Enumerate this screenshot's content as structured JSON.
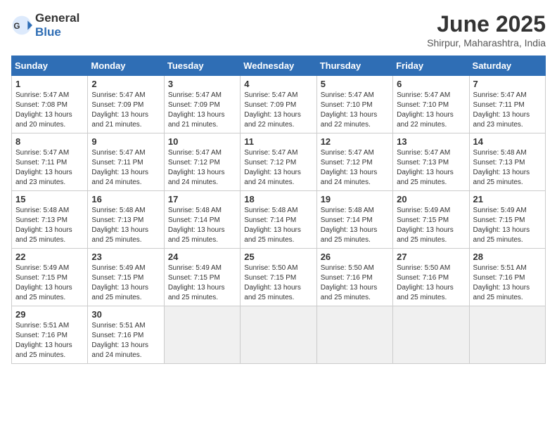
{
  "header": {
    "logo_general": "General",
    "logo_blue": "Blue",
    "month_year": "June 2025",
    "location": "Shirpur, Maharashtra, India"
  },
  "weekdays": [
    "Sunday",
    "Monday",
    "Tuesday",
    "Wednesday",
    "Thursday",
    "Friday",
    "Saturday"
  ],
  "weeks": [
    [
      {
        "day": "1",
        "lines": [
          "Sunrise: 5:47 AM",
          "Sunset: 7:08 PM",
          "Daylight: 13 hours",
          "and 20 minutes."
        ]
      },
      {
        "day": "2",
        "lines": [
          "Sunrise: 5:47 AM",
          "Sunset: 7:09 PM",
          "Daylight: 13 hours",
          "and 21 minutes."
        ]
      },
      {
        "day": "3",
        "lines": [
          "Sunrise: 5:47 AM",
          "Sunset: 7:09 PM",
          "Daylight: 13 hours",
          "and 21 minutes."
        ]
      },
      {
        "day": "4",
        "lines": [
          "Sunrise: 5:47 AM",
          "Sunset: 7:09 PM",
          "Daylight: 13 hours",
          "and 22 minutes."
        ]
      },
      {
        "day": "5",
        "lines": [
          "Sunrise: 5:47 AM",
          "Sunset: 7:10 PM",
          "Daylight: 13 hours",
          "and 22 minutes."
        ]
      },
      {
        "day": "6",
        "lines": [
          "Sunrise: 5:47 AM",
          "Sunset: 7:10 PM",
          "Daylight: 13 hours",
          "and 22 minutes."
        ]
      },
      {
        "day": "7",
        "lines": [
          "Sunrise: 5:47 AM",
          "Sunset: 7:11 PM",
          "Daylight: 13 hours",
          "and 23 minutes."
        ]
      }
    ],
    [
      {
        "day": "8",
        "lines": [
          "Sunrise: 5:47 AM",
          "Sunset: 7:11 PM",
          "Daylight: 13 hours",
          "and 23 minutes."
        ]
      },
      {
        "day": "9",
        "lines": [
          "Sunrise: 5:47 AM",
          "Sunset: 7:11 PM",
          "Daylight: 13 hours",
          "and 24 minutes."
        ]
      },
      {
        "day": "10",
        "lines": [
          "Sunrise: 5:47 AM",
          "Sunset: 7:12 PM",
          "Daylight: 13 hours",
          "and 24 minutes."
        ]
      },
      {
        "day": "11",
        "lines": [
          "Sunrise: 5:47 AM",
          "Sunset: 7:12 PM",
          "Daylight: 13 hours",
          "and 24 minutes."
        ]
      },
      {
        "day": "12",
        "lines": [
          "Sunrise: 5:47 AM",
          "Sunset: 7:12 PM",
          "Daylight: 13 hours",
          "and 24 minutes."
        ]
      },
      {
        "day": "13",
        "lines": [
          "Sunrise: 5:47 AM",
          "Sunset: 7:13 PM",
          "Daylight: 13 hours",
          "and 25 minutes."
        ]
      },
      {
        "day": "14",
        "lines": [
          "Sunrise: 5:48 AM",
          "Sunset: 7:13 PM",
          "Daylight: 13 hours",
          "and 25 minutes."
        ]
      }
    ],
    [
      {
        "day": "15",
        "lines": [
          "Sunrise: 5:48 AM",
          "Sunset: 7:13 PM",
          "Daylight: 13 hours",
          "and 25 minutes."
        ]
      },
      {
        "day": "16",
        "lines": [
          "Sunrise: 5:48 AM",
          "Sunset: 7:13 PM",
          "Daylight: 13 hours",
          "and 25 minutes."
        ]
      },
      {
        "day": "17",
        "lines": [
          "Sunrise: 5:48 AM",
          "Sunset: 7:14 PM",
          "Daylight: 13 hours",
          "and 25 minutes."
        ]
      },
      {
        "day": "18",
        "lines": [
          "Sunrise: 5:48 AM",
          "Sunset: 7:14 PM",
          "Daylight: 13 hours",
          "and 25 minutes."
        ]
      },
      {
        "day": "19",
        "lines": [
          "Sunrise: 5:48 AM",
          "Sunset: 7:14 PM",
          "Daylight: 13 hours",
          "and 25 minutes."
        ]
      },
      {
        "day": "20",
        "lines": [
          "Sunrise: 5:49 AM",
          "Sunset: 7:15 PM",
          "Daylight: 13 hours",
          "and 25 minutes."
        ]
      },
      {
        "day": "21",
        "lines": [
          "Sunrise: 5:49 AM",
          "Sunset: 7:15 PM",
          "Daylight: 13 hours",
          "and 25 minutes."
        ]
      }
    ],
    [
      {
        "day": "22",
        "lines": [
          "Sunrise: 5:49 AM",
          "Sunset: 7:15 PM",
          "Daylight: 13 hours",
          "and 25 minutes."
        ]
      },
      {
        "day": "23",
        "lines": [
          "Sunrise: 5:49 AM",
          "Sunset: 7:15 PM",
          "Daylight: 13 hours",
          "and 25 minutes."
        ]
      },
      {
        "day": "24",
        "lines": [
          "Sunrise: 5:49 AM",
          "Sunset: 7:15 PM",
          "Daylight: 13 hours",
          "and 25 minutes."
        ]
      },
      {
        "day": "25",
        "lines": [
          "Sunrise: 5:50 AM",
          "Sunset: 7:15 PM",
          "Daylight: 13 hours",
          "and 25 minutes."
        ]
      },
      {
        "day": "26",
        "lines": [
          "Sunrise: 5:50 AM",
          "Sunset: 7:16 PM",
          "Daylight: 13 hours",
          "and 25 minutes."
        ]
      },
      {
        "day": "27",
        "lines": [
          "Sunrise: 5:50 AM",
          "Sunset: 7:16 PM",
          "Daylight: 13 hours",
          "and 25 minutes."
        ]
      },
      {
        "day": "28",
        "lines": [
          "Sunrise: 5:51 AM",
          "Sunset: 7:16 PM",
          "Daylight: 13 hours",
          "and 25 minutes."
        ]
      }
    ],
    [
      {
        "day": "29",
        "lines": [
          "Sunrise: 5:51 AM",
          "Sunset: 7:16 PM",
          "Daylight: 13 hours",
          "and 25 minutes."
        ]
      },
      {
        "day": "30",
        "lines": [
          "Sunrise: 5:51 AM",
          "Sunset: 7:16 PM",
          "Daylight: 13 hours",
          "and 24 minutes."
        ]
      },
      null,
      null,
      null,
      null,
      null
    ]
  ]
}
